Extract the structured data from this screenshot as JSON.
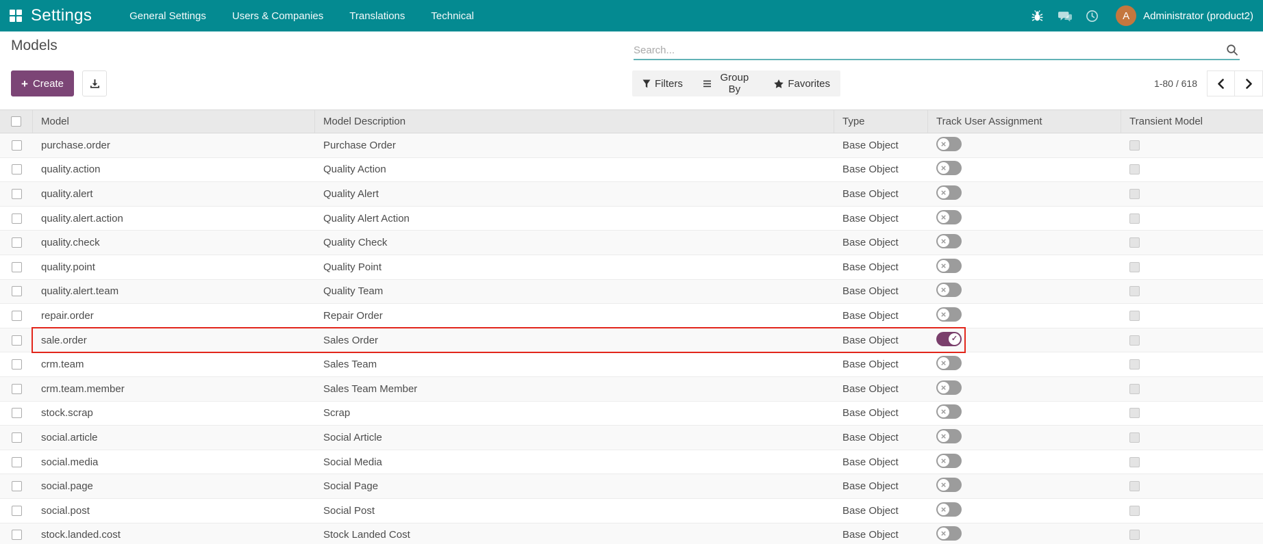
{
  "topbar": {
    "app_title": "Settings",
    "menu_items": [
      "General Settings",
      "Users & Companies",
      "Translations",
      "Technical"
    ],
    "user_name": "Administrator (product2)",
    "avatar_initial": "A",
    "colors": {
      "bar": "#048a91",
      "avatar": "#c4773e"
    }
  },
  "control_panel": {
    "breadcrumb": "Models",
    "create_label": "Create",
    "search_placeholder": "Search...",
    "filters_label": "Filters",
    "group_by_label": "Group By",
    "favorites_label": "Favorites",
    "pager_text": "1-80 / 618"
  },
  "table": {
    "columns": [
      "Model",
      "Model Description",
      "Type",
      "Track User Assignment",
      "Transient Model"
    ],
    "accent_colors": {
      "toggle_on": "#7a3f6c",
      "toggle_off": "#9c9c9c",
      "annotation": "#e2261b"
    },
    "rows": [
      {
        "model": "purchase.order",
        "description": "Purchase Order",
        "type": "Base Object",
        "track": false,
        "transient": false,
        "highlighted": false
      },
      {
        "model": "quality.action",
        "description": "Quality Action",
        "type": "Base Object",
        "track": false,
        "transient": false,
        "highlighted": false
      },
      {
        "model": "quality.alert",
        "description": "Quality Alert",
        "type": "Base Object",
        "track": false,
        "transient": false,
        "highlighted": false
      },
      {
        "model": "quality.alert.action",
        "description": "Quality Alert Action",
        "type": "Base Object",
        "track": false,
        "transient": false,
        "highlighted": false
      },
      {
        "model": "quality.check",
        "description": "Quality Check",
        "type": "Base Object",
        "track": false,
        "transient": false,
        "highlighted": false
      },
      {
        "model": "quality.point",
        "description": "Quality Point",
        "type": "Base Object",
        "track": false,
        "transient": false,
        "highlighted": false
      },
      {
        "model": "quality.alert.team",
        "description": "Quality Team",
        "type": "Base Object",
        "track": false,
        "transient": false,
        "highlighted": false
      },
      {
        "model": "repair.order",
        "description": "Repair Order",
        "type": "Base Object",
        "track": false,
        "transient": false,
        "highlighted": false
      },
      {
        "model": "sale.order",
        "description": "Sales Order",
        "type": "Base Object",
        "track": true,
        "transient": false,
        "highlighted": true
      },
      {
        "model": "crm.team",
        "description": "Sales Team",
        "type": "Base Object",
        "track": false,
        "transient": false,
        "highlighted": false
      },
      {
        "model": "crm.team.member",
        "description": "Sales Team Member",
        "type": "Base Object",
        "track": false,
        "transient": false,
        "highlighted": false
      },
      {
        "model": "stock.scrap",
        "description": "Scrap",
        "type": "Base Object",
        "track": false,
        "transient": false,
        "highlighted": false
      },
      {
        "model": "social.article",
        "description": "Social Article",
        "type": "Base Object",
        "track": false,
        "transient": false,
        "highlighted": false
      },
      {
        "model": "social.media",
        "description": "Social Media",
        "type": "Base Object",
        "track": false,
        "transient": false,
        "highlighted": false
      },
      {
        "model": "social.page",
        "description": "Social Page",
        "type": "Base Object",
        "track": false,
        "transient": false,
        "highlighted": false
      },
      {
        "model": "social.post",
        "description": "Social Post",
        "type": "Base Object",
        "track": false,
        "transient": false,
        "highlighted": false
      },
      {
        "model": "stock.landed.cost",
        "description": "Stock Landed Cost",
        "type": "Base Object",
        "track": false,
        "transient": false,
        "highlighted": false
      }
    ]
  }
}
